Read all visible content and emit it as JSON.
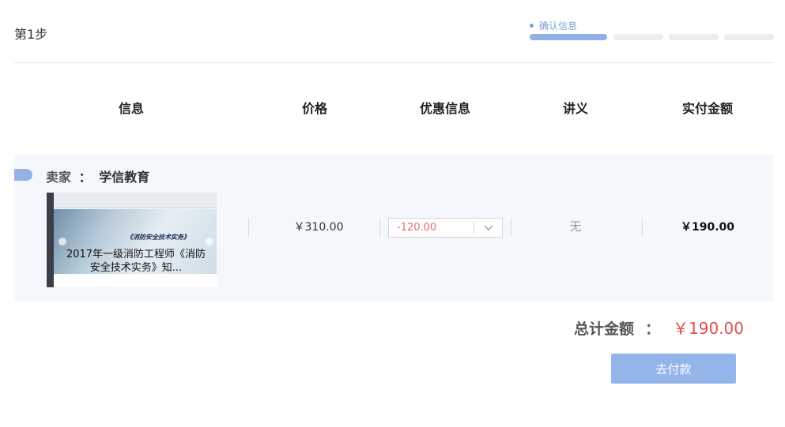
{
  "step": {
    "title": "第1步"
  },
  "progress": {
    "current_label": "确认信息",
    "steps_total": 4,
    "steps_completed": 1
  },
  "table": {
    "headers": [
      "信息",
      "价格",
      "优惠信息",
      "讲义",
      "实付金额"
    ]
  },
  "order": {
    "seller_label": "卖家",
    "seller_separator": "：",
    "seller_name": "学信教育",
    "course_title": "2017年一级消防工程师《消防安全技术实务》知...",
    "thumbnail_slide_title": "《消防安全技术实务》",
    "price": "￥310.00",
    "discount": "-120.00",
    "handout": "无",
    "actual_paid": "￥190.00"
  },
  "summary": {
    "total_label": "总计金额",
    "total_separator": "：",
    "total_amount": "￥190.00"
  },
  "actions": {
    "pay_label": "去付款"
  },
  "colors": {
    "accent": "#94b5ea",
    "price_red": "#e04e4e",
    "discount_red": "#e46f6f",
    "panel_bg": "#f4f7fb"
  }
}
